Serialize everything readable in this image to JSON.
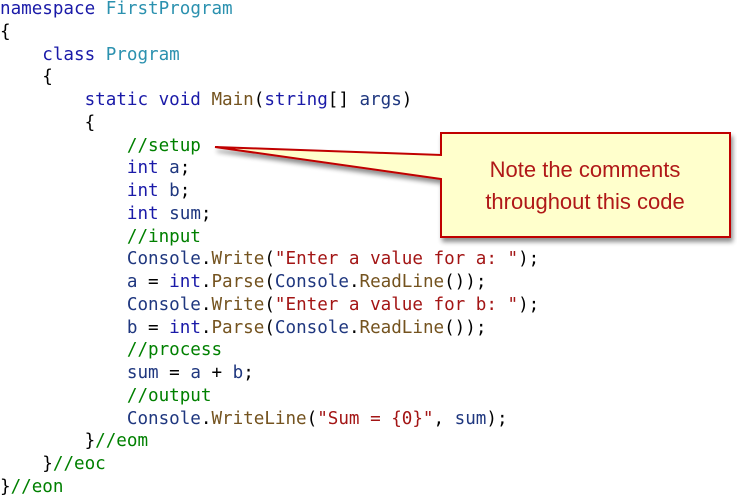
{
  "code": {
    "language": "C#",
    "lines": [
      [
        {
          "t": "namespace ",
          "c": "keyword"
        },
        {
          "t": "FirstProgram",
          "c": "type"
        }
      ],
      [
        {
          "t": "{",
          "c": "punct"
        }
      ],
      [
        {
          "t": "    class ",
          "c": "keyword"
        },
        {
          "t": "Program",
          "c": "type"
        }
      ],
      [
        {
          "t": "    {",
          "c": "punct"
        }
      ],
      [
        {
          "t": "        static void ",
          "c": "keyword"
        },
        {
          "t": "Main",
          "c": "method"
        },
        {
          "t": "(",
          "c": "punct"
        },
        {
          "t": "string",
          "c": "keyword"
        },
        {
          "t": "[] ",
          "c": "punct"
        },
        {
          "t": "args",
          "c": "ident"
        },
        {
          "t": ")",
          "c": "punct"
        }
      ],
      [
        {
          "t": "        {",
          "c": "punct"
        }
      ],
      [
        {
          "t": "            //setup",
          "c": "comment"
        }
      ],
      [
        {
          "t": "            int ",
          "c": "keyword"
        },
        {
          "t": "a",
          "c": "ident"
        },
        {
          "t": ";",
          "c": "punct"
        }
      ],
      [
        {
          "t": "            int ",
          "c": "keyword"
        },
        {
          "t": "b",
          "c": "ident"
        },
        {
          "t": ";",
          "c": "punct"
        }
      ],
      [
        {
          "t": "            int ",
          "c": "keyword"
        },
        {
          "t": "sum",
          "c": "ident"
        },
        {
          "t": ";",
          "c": "punct"
        }
      ],
      [
        {
          "t": "            //input",
          "c": "comment"
        }
      ],
      [
        {
          "t": "            ",
          "c": "punct"
        },
        {
          "t": "Console",
          "c": "ident"
        },
        {
          "t": ".",
          "c": "punct"
        },
        {
          "t": "Write",
          "c": "method"
        },
        {
          "t": "(",
          "c": "punct"
        },
        {
          "t": "\"Enter a value for a: \"",
          "c": "string"
        },
        {
          "t": ");",
          "c": "punct"
        }
      ],
      [
        {
          "t": "            ",
          "c": "punct"
        },
        {
          "t": "a",
          "c": "ident"
        },
        {
          "t": " = ",
          "c": "punct"
        },
        {
          "t": "int",
          "c": "keyword"
        },
        {
          "t": ".",
          "c": "punct"
        },
        {
          "t": "Parse",
          "c": "method"
        },
        {
          "t": "(",
          "c": "punct"
        },
        {
          "t": "Console",
          "c": "ident"
        },
        {
          "t": ".",
          "c": "punct"
        },
        {
          "t": "ReadLine",
          "c": "method"
        },
        {
          "t": "());",
          "c": "punct"
        }
      ],
      [
        {
          "t": "            ",
          "c": "punct"
        },
        {
          "t": "Console",
          "c": "ident"
        },
        {
          "t": ".",
          "c": "punct"
        },
        {
          "t": "Write",
          "c": "method"
        },
        {
          "t": "(",
          "c": "punct"
        },
        {
          "t": "\"Enter a value for b: \"",
          "c": "string"
        },
        {
          "t": ");",
          "c": "punct"
        }
      ],
      [
        {
          "t": "            ",
          "c": "punct"
        },
        {
          "t": "b",
          "c": "ident"
        },
        {
          "t": " = ",
          "c": "punct"
        },
        {
          "t": "int",
          "c": "keyword"
        },
        {
          "t": ".",
          "c": "punct"
        },
        {
          "t": "Parse",
          "c": "method"
        },
        {
          "t": "(",
          "c": "punct"
        },
        {
          "t": "Console",
          "c": "ident"
        },
        {
          "t": ".",
          "c": "punct"
        },
        {
          "t": "ReadLine",
          "c": "method"
        },
        {
          "t": "());",
          "c": "punct"
        }
      ],
      [
        {
          "t": "            //process",
          "c": "comment"
        }
      ],
      [
        {
          "t": "            ",
          "c": "punct"
        },
        {
          "t": "sum",
          "c": "ident"
        },
        {
          "t": " = ",
          "c": "punct"
        },
        {
          "t": "a",
          "c": "ident"
        },
        {
          "t": " + ",
          "c": "punct"
        },
        {
          "t": "b",
          "c": "ident"
        },
        {
          "t": ";",
          "c": "punct"
        }
      ],
      [
        {
          "t": "            //output",
          "c": "comment"
        }
      ],
      [
        {
          "t": "            ",
          "c": "punct"
        },
        {
          "t": "Console",
          "c": "ident"
        },
        {
          "t": ".",
          "c": "punct"
        },
        {
          "t": "WriteLine",
          "c": "method"
        },
        {
          "t": "(",
          "c": "punct"
        },
        {
          "t": "\"Sum = {0}\"",
          "c": "string"
        },
        {
          "t": ", ",
          "c": "punct"
        },
        {
          "t": "sum",
          "c": "ident"
        },
        {
          "t": ");",
          "c": "punct"
        }
      ],
      [
        {
          "t": "        }",
          "c": "punct"
        },
        {
          "t": "//eom",
          "c": "comment"
        }
      ],
      [
        {
          "t": "    }",
          "c": "punct"
        },
        {
          "t": "//eoc",
          "c": "comment"
        }
      ],
      [
        {
          "t": "}",
          "c": "punct"
        },
        {
          "t": "//eon",
          "c": "comment"
        }
      ]
    ]
  },
  "callout": {
    "line1": "Note the comments",
    "line2": "throughout this code",
    "points_to": "//setup",
    "border_color": "#c00000",
    "fill_color": "#ffffcc",
    "text_color": "#b01818"
  },
  "colors": {
    "keyword": "#1a1aa8",
    "type": "#2b91af",
    "method": "#74531f",
    "identifier": "#1f377f",
    "string": "#a31515",
    "comment": "#008000"
  }
}
